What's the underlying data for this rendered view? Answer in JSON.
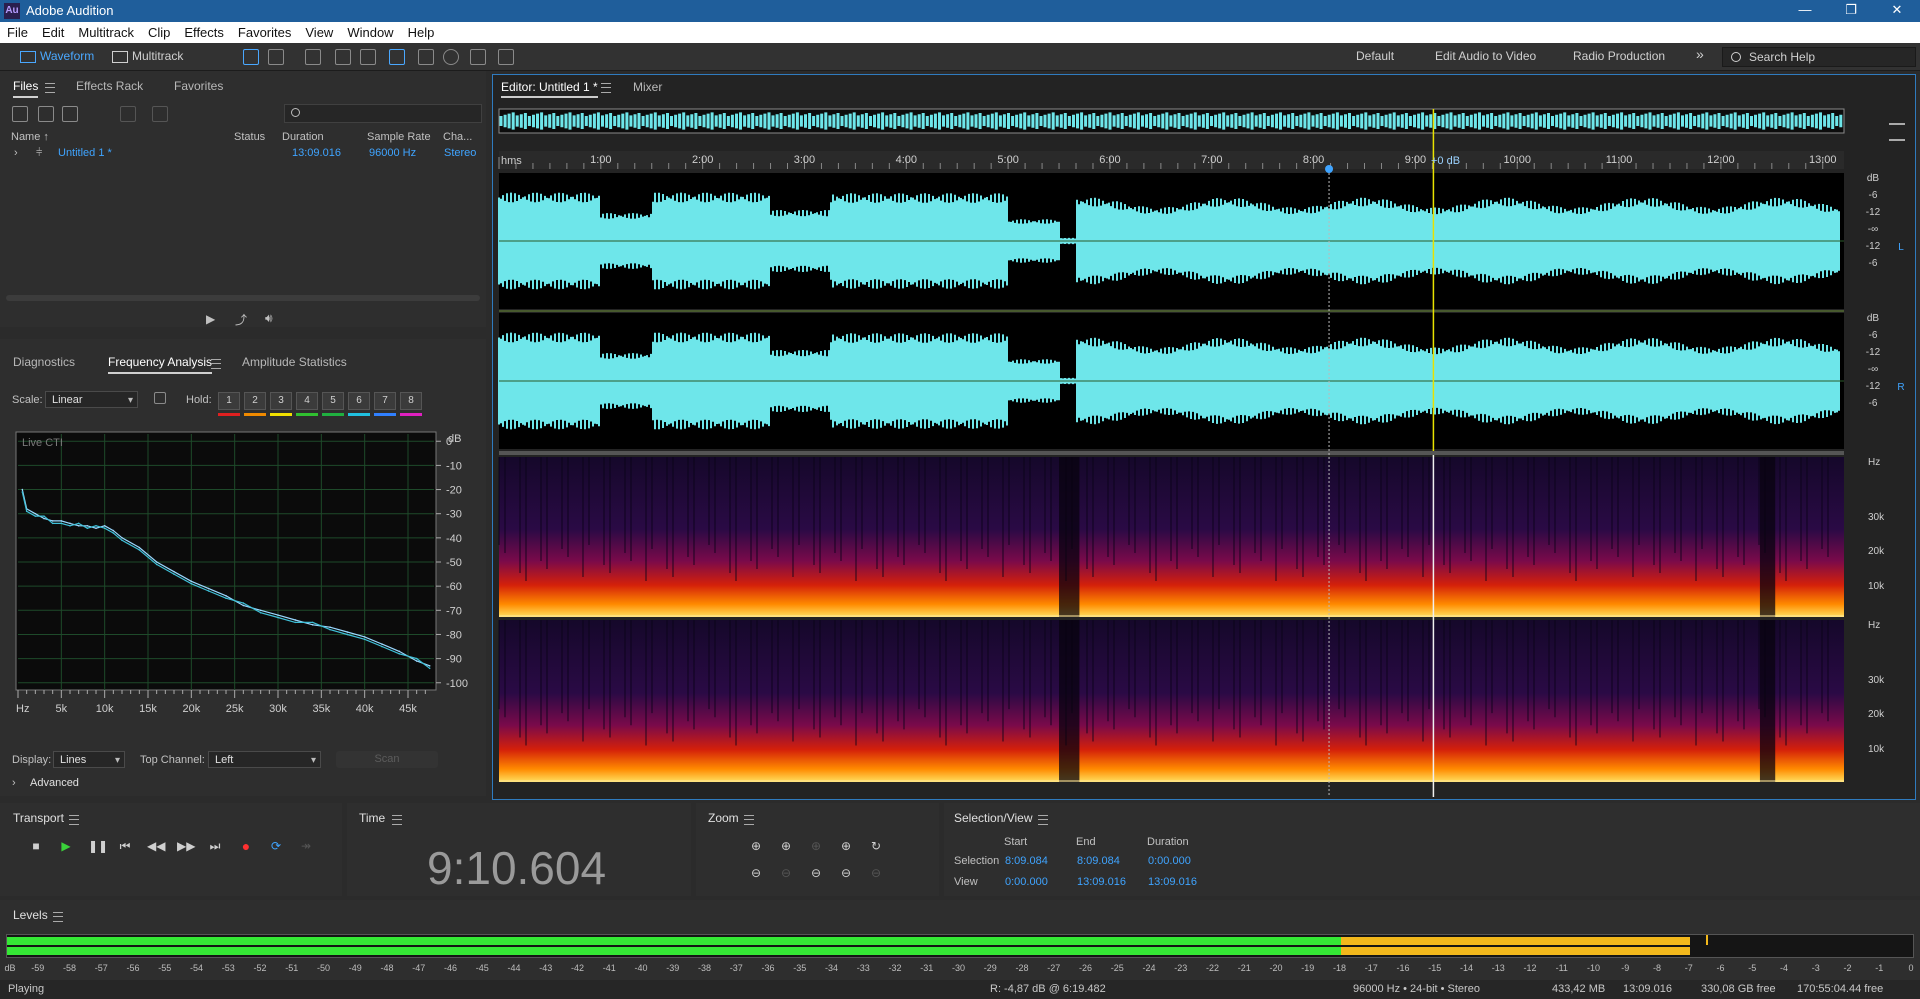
{
  "window": {
    "title": "Adobe Audition",
    "app_icon": "Au",
    "min": "—",
    "restore": "❐",
    "close": "✕"
  },
  "menu": [
    "File",
    "Edit",
    "Multitrack",
    "Clip",
    "Effects",
    "Favorites",
    "View",
    "Window",
    "Help"
  ],
  "toolbar": {
    "waveform_label": "Waveform",
    "multitrack_label": "Multitrack",
    "workspaces": [
      "Default",
      "Edit Audio to Video",
      "Radio Production"
    ],
    "more": "»",
    "search_placeholder": "Search Help"
  },
  "files_panel": {
    "tabs": [
      "Files",
      "Effects Rack",
      "Favorites"
    ],
    "search_icon": "search-icon",
    "columns": [
      "Name ↑",
      "Status",
      "Duration",
      "Sample Rate",
      "Cha..."
    ],
    "rows": [
      {
        "name": "Untitled 1 *",
        "status": "",
        "duration": "13:09.016",
        "sample_rate": "96000 Hz",
        "channels": "Stereo"
      }
    ]
  },
  "analysis_panel": {
    "tabs": [
      "Diagnostics",
      "Frequency Analysis",
      "Amplitude Statistics"
    ],
    "scale_label": "Scale:",
    "scale_value": "Linear",
    "hold_label": "Hold:",
    "hold_buttons": [
      "1",
      "2",
      "3",
      "4",
      "5",
      "6",
      "7",
      "8"
    ],
    "hold_colors": [
      "#e02020",
      "#f08a00",
      "#f0e000",
      "#30c030",
      "#20b040",
      "#20c0e0",
      "#3080ff",
      "#e020c0"
    ],
    "display_label": "Display:",
    "display_value": "Lines",
    "top_channel_label": "Top Channel:",
    "top_channel_value": "Left",
    "scan_label": "Scan",
    "advanced_label": "Advanced"
  },
  "chart_data": {
    "type": "line",
    "annotation": "Live CTI",
    "xlabel": "",
    "ylabel": "",
    "x_unit_tick": "Hz",
    "x_ticks": [
      "5k",
      "10k",
      "15k",
      "20k",
      "25k",
      "30k",
      "35k",
      "40k",
      "45k"
    ],
    "y_unit_tick": "dB",
    "y_ticks": [
      "0",
      "-10",
      "-20",
      "-30",
      "-40",
      "-50",
      "-60",
      "-70",
      "-80",
      "-90",
      "-100"
    ],
    "xlim": [
      0,
      48000
    ],
    "ylim": [
      -103,
      3
    ],
    "grid": true,
    "x": [
      500,
      1000,
      2000,
      3000,
      4000,
      5000,
      6000,
      7000,
      8000,
      9000,
      10000,
      11000,
      12000,
      14000,
      16000,
      18000,
      20000,
      22000,
      24000,
      26000,
      28000,
      30000,
      32000,
      34000,
      36000,
      38000,
      40000,
      42000,
      44000,
      46000,
      47500
    ],
    "series": [
      {
        "color": "#9ad8ff",
        "values": [
          -20,
          -28,
          -30,
          -32,
          -33,
          -33,
          -34,
          -35,
          -35,
          -36,
          -35,
          -37,
          -40,
          -44,
          -50,
          -54,
          -58,
          -61,
          -64,
          -68,
          -70,
          -72,
          -74,
          -76,
          -77,
          -79,
          -81,
          -84,
          -87,
          -91,
          -93
        ]
      },
      {
        "color": "#3fc0d8",
        "values": [
          -21,
          -29,
          -31,
          -31,
          -34,
          -34,
          -35,
          -34,
          -36,
          -35,
          -36,
          -38,
          -41,
          -45,
          -51,
          -55,
          -59,
          -62,
          -65,
          -67,
          -71,
          -73,
          -75,
          -75,
          -78,
          -80,
          -82,
          -85,
          -88,
          -90,
          -94
        ]
      }
    ]
  },
  "editor": {
    "tabs": [
      "Editor: Untitled 1 *",
      "Mixer"
    ],
    "ruler_unit": "hms",
    "ruler_ticks": [
      "1:00",
      "2:00",
      "3:00",
      "4:00",
      "5:00",
      "6:00",
      "7:00",
      "8:00",
      "9:00",
      "10:00",
      "11:00",
      "12:00",
      "13:00"
    ],
    "db_labels_top": [
      "dB",
      "-6",
      "-12",
      "-∞",
      "-12",
      "-6"
    ],
    "db_labels_bottom": [
      "dB",
      "-6",
      "-12",
      "-∞",
      "-12",
      "-6"
    ],
    "channel_left": "L",
    "channel_right": "R",
    "hz_top": [
      "Hz",
      "30k",
      "20k",
      "10k"
    ],
    "hz_bottom": [
      "Hz",
      "30k",
      "20k",
      "10k"
    ],
    "gain": "+0 dB",
    "waveform_color": "#6ee6ea",
    "playhead_color": "#e8e200"
  },
  "transport": {
    "title": "Transport"
  },
  "time": {
    "title": "Time",
    "value": "9:10.604"
  },
  "zoom": {
    "title": "Zoom"
  },
  "selection_view": {
    "title": "Selection/View",
    "headers": [
      "Start",
      "End",
      "Duration"
    ],
    "rows": [
      {
        "label": "Selection",
        "start": "8:09.084",
        "end": "8:09.084",
        "duration": "0:00.000"
      },
      {
        "label": "View",
        "start": "0:00.000",
        "end": "13:09.016",
        "duration": "13:09.016"
      }
    ]
  },
  "levels": {
    "title": "Levels",
    "ticks": [
      "dB",
      "-59",
      "-58",
      "-57",
      "-56",
      "-55",
      "-54",
      "-53",
      "-52",
      "-51",
      "-50",
      "-49",
      "-48",
      "-47",
      "-46",
      "-45",
      "-44",
      "-43",
      "-42",
      "-41",
      "-40",
      "-39",
      "-38",
      "-37",
      "-36",
      "-35",
      "-34",
      "-33",
      "-32",
      "-31",
      "-30",
      "-29",
      "-28",
      "-27",
      "-26",
      "-25",
      "-24",
      "-23",
      "-22",
      "-21",
      "-20",
      "-19",
      "-18",
      "-17",
      "-16",
      "-15",
      "-14",
      "-13",
      "-12",
      "-11",
      "-10",
      "-9",
      "-8",
      "-7",
      "-6",
      "-5",
      "-4",
      "-3",
      "-2",
      "-1",
      "0"
    ],
    "green_until_db": -18,
    "yellow_until_db": -7,
    "peak_db": -6.5
  },
  "status": {
    "state": "Playing",
    "cursor": "R: -4,87 dB @ 6:19.482",
    "format": "96000 Hz • 24-bit • Stereo",
    "size": "433,42 MB",
    "duration": "13:09.016",
    "free": "330,08 GB free",
    "free_time": "170:55:04.44 free"
  }
}
